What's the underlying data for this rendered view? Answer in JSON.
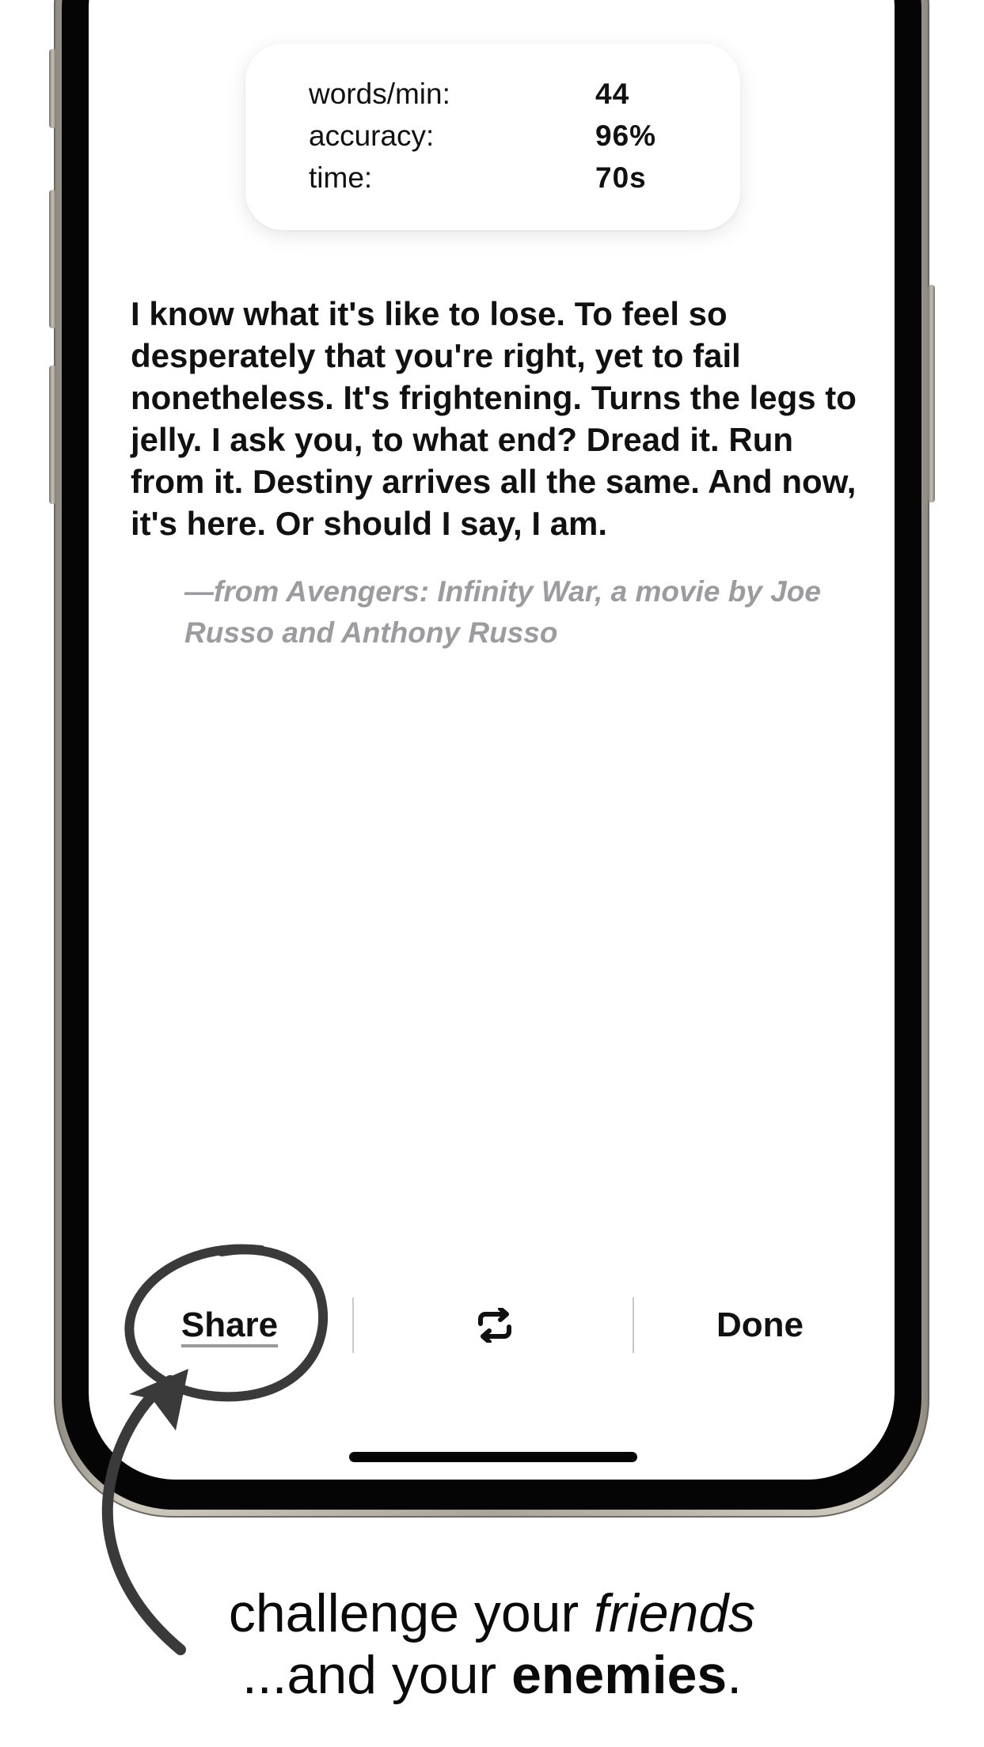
{
  "stats": {
    "rows": [
      {
        "label": "words/min:",
        "value": "44"
      },
      {
        "label": "accuracy:",
        "value": "96%"
      },
      {
        "label": "time:",
        "value": "70s"
      }
    ]
  },
  "quote": {
    "text": "I know what it's like to lose. To feel so desperately that you're right, yet to fail nonetheless. It's frightening. Turns the legs to jelly. I ask you, to what end? Dread it. Run from it. Destiny arrives all the same. And now, it's here. Or should I say, I am.",
    "source": "—from Avengers: Infinity War, a movie by Joe Russo and Anthony Russo"
  },
  "toolbar": {
    "share_label": "Share",
    "repeat_icon": "repeat-icon",
    "done_label": "Done"
  },
  "caption": {
    "line1_prefix": "challenge your ",
    "line1_emphasis": "friends",
    "line2_prefix": "...and your ",
    "line2_strong": "enemies",
    "line2_suffix": "."
  },
  "colors": {
    "text": "#111111",
    "source_gray": "#9b9ba0",
    "phone_frame": "#b8b3a9",
    "bezel": "#050505",
    "annotation": "#3a3a3a"
  }
}
